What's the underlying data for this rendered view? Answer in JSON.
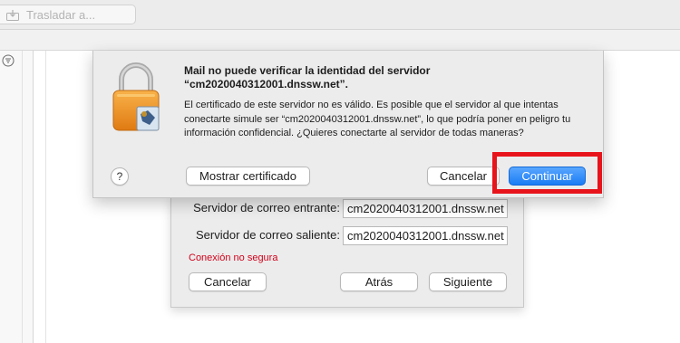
{
  "toolbar": {
    "move_label": "Trasladar a...",
    "move_icon": "tray-arrow-icon"
  },
  "sidebar": {
    "filter_icon": "filter-icon"
  },
  "alert": {
    "title": "Mail no puede verificar la identidad del servidor “cm2020040312001.dnssw.net”.",
    "body": "El certificado de este servidor no es válido. Es posible que el servidor al que intentas conectarte simule ser “cm2020040312001.dnssw.net”, lo que podría poner en peligro tu información confidencial. ¿Quieres conectarte al servidor de todas maneras?",
    "icon": "lock-certificate-icon",
    "help_label": "?",
    "show_cert_label": "Mostrar certificado",
    "cancel_label": "Cancelar",
    "continue_label": "Continuar"
  },
  "account_sheet": {
    "incoming_label": "Servidor de correo entrante:",
    "incoming_value": "cm2020040312001.dnssw.net",
    "outgoing_label": "Servidor de correo saliente:",
    "outgoing_value": "cm2020040312001.dnssw.net",
    "insecure_text": "Conexión no segura",
    "cancel_label": "Cancelar",
    "back_label": "Atrás",
    "next_label": "Siguiente"
  },
  "colors": {
    "highlight": "#e8141c",
    "primary": "#1a7cf5",
    "warning_text": "#d0021b"
  }
}
